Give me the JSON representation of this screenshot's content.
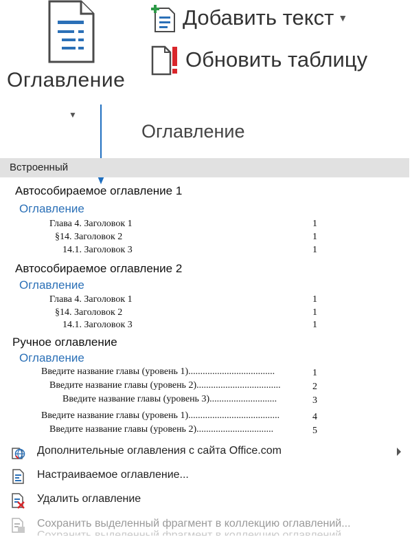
{
  "ribbon": {
    "toc_button_label": "Оглавление",
    "add_text_label": "Добавить текст",
    "update_table_label": "Обновить таблицу",
    "group_label": "Оглавление"
  },
  "gallery": {
    "header": "Встроенный",
    "auto1": {
      "title": "Автособираемое оглавление 1",
      "subtitle": "Оглавление",
      "lines": [
        "Глава 4. Заголовок 1",
        "§14. Заголовок 2",
        "14.1. Заголовок 3"
      ],
      "pages": [
        "1",
        "1",
        "1"
      ]
    },
    "auto2": {
      "title": "Автособираемое оглавление 2",
      "subtitle": "Оглавление",
      "lines": [
        "Глава 4. Заголовок 1",
        "§14. Заголовок 2",
        "14.1. Заголовок 3"
      ],
      "pages": [
        "1",
        "1",
        "1"
      ]
    },
    "manual": {
      "title": "Ручное оглавление",
      "subtitle": "Оглавление",
      "lines": [
        "Введите название главы (уровень 1)....................................",
        "Введите название главы (уровень 2)...................................",
        "Введите название главы (уровень 3)............................",
        "Введите название главы (уровень 1)......................................",
        "Введите название главы (уровень 2)................................"
      ],
      "pages": [
        "1",
        "2",
        "3",
        "4",
        "5"
      ]
    }
  },
  "menu": {
    "more_from_office": "Дополнительные оглавления с сайта Office.com",
    "custom_toc": "Настраиваемое оглавление...",
    "remove_toc": "Удалить оглавление",
    "save_selection": "Сохранить выделенный фрагмент в коллекцию оглавлений...",
    "cut_line": "Сохранить выделенный фрагмент в коллекцию оглавлений..."
  },
  "colors": {
    "accent_blue": "#2b70b7",
    "arrow_blue": "#1f6fc0",
    "header_gray": "#e1e1e1",
    "alert_red": "#d9262b"
  }
}
